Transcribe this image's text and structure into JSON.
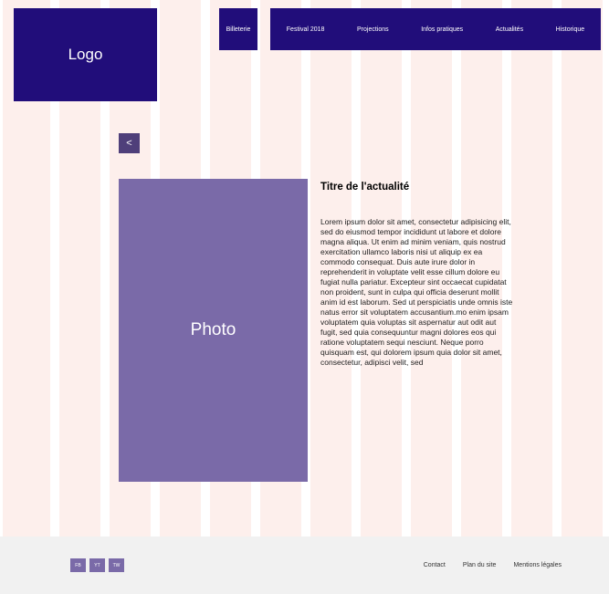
{
  "header": {
    "logo": "Logo"
  },
  "nav": {
    "billeterie": "Billeterie",
    "items": [
      {
        "label": "Festival 2018"
      },
      {
        "label": "Projections"
      },
      {
        "label": "Infos pratiques"
      },
      {
        "label": "Actualités"
      },
      {
        "label": "Historique"
      }
    ]
  },
  "back_button": {
    "label": "<"
  },
  "photo": {
    "label": "Photo"
  },
  "article": {
    "title": "Titre de l'actualité",
    "body": "Lorem ipsum dolor sit amet, consectetur adipisicing elit, sed do eiusmod tempor incididunt ut labore et dolore magna aliqua. Ut enim ad minim veniam, quis nostrud exercitation ullamco laboris nisi ut aliquip ex ea commodo consequat. Duis aute irure dolor in reprehenderit in voluptate velit esse cillum dolore eu fugiat nulla pariatur. Excepteur sint occaecat cupidatat non proident, sunt in culpa qui officia deserunt mollit anim id est laborum. Sed ut perspiciatis unde omnis iste natus error sit voluptatem accusantium.mo enim ipsam voluptatem quia voluptas sit aspernatur aut odit aut fugit, sed quia consequuntur magni dolores eos qui ratione voluptatem sequi nesciunt. Neque porro quisquam est, qui dolorem ipsum quia dolor sit amet, consectetur, adipisci velit, sed"
  },
  "footer": {
    "social": [
      {
        "label": "FB"
      },
      {
        "label": "YT"
      },
      {
        "label": "TW"
      }
    ],
    "links": [
      {
        "label": "Contact"
      },
      {
        "label": "Plan du site"
      },
      {
        "label": "Mentions légales"
      }
    ]
  }
}
